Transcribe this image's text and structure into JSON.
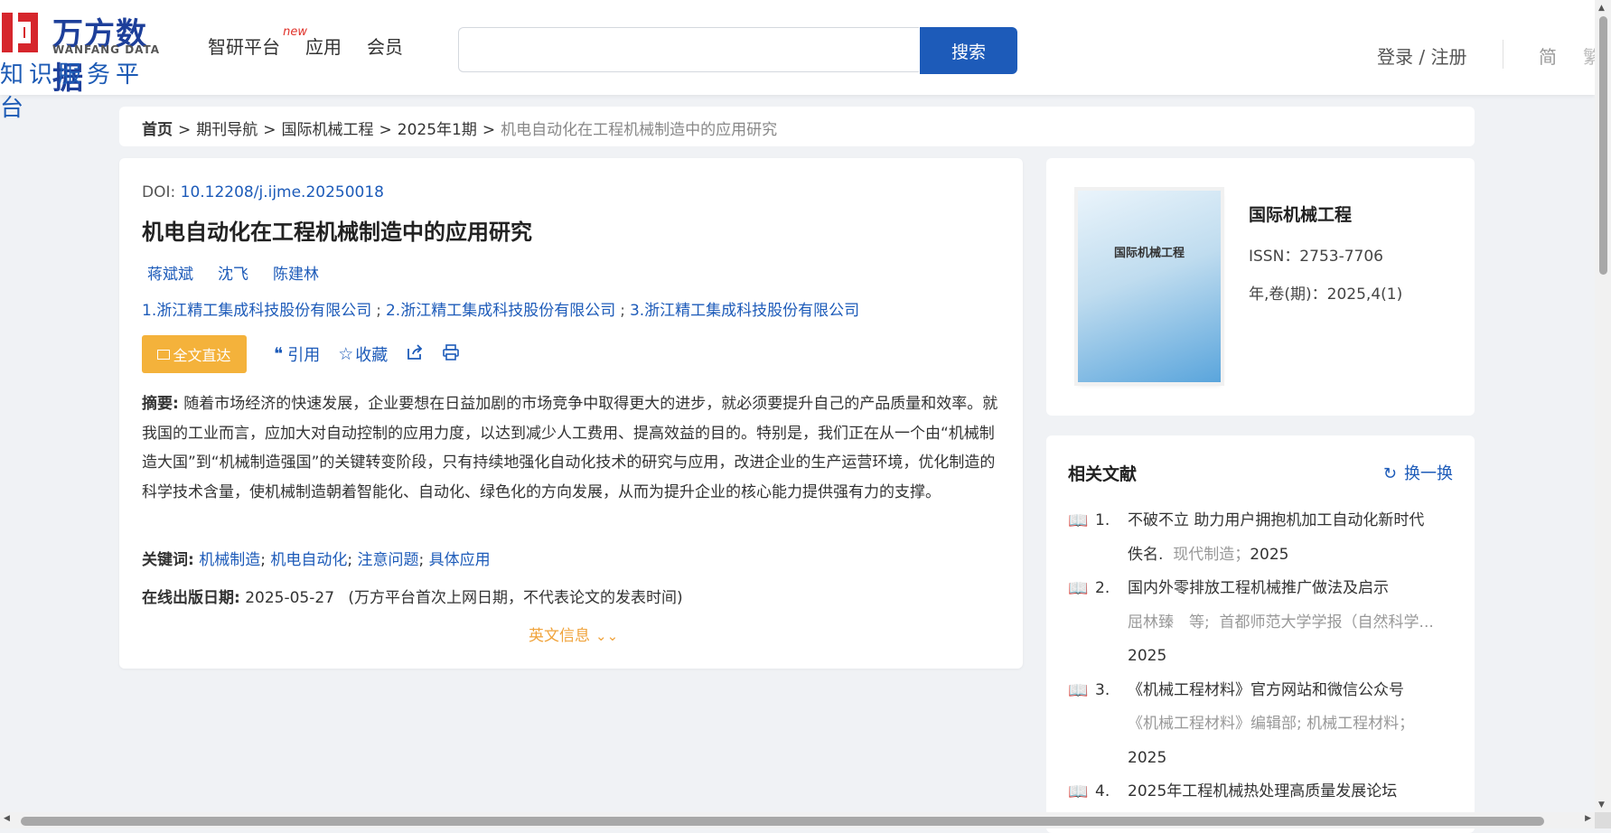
{
  "header": {
    "logo": {
      "cn": "万方数据",
      "en": "WANFANG DATA",
      "sub": "知识服务平台"
    },
    "nav": [
      {
        "label": "智研平台",
        "badge": "new"
      },
      {
        "label": "应用"
      },
      {
        "label": "会员"
      }
    ],
    "search": {
      "placeholder": "",
      "button_label": "搜索"
    },
    "login_label": "登录 / 注册",
    "lang_simplified": "简",
    "lang_traditional": "繁"
  },
  "breadcrumb": {
    "home": "首页",
    "items": [
      "期刊导航",
      "国际机械工程",
      "2025年1期"
    ],
    "current": "机电自动化在工程机械制造中的应用研究",
    "separator": ">"
  },
  "article": {
    "doi_label": "DOI: ",
    "doi": "10.12208/j.ijme.20250018",
    "title": "机电自动化在工程机械制造中的应用研究",
    "authors": [
      "蒋斌斌",
      "沈飞",
      "陈建林"
    ],
    "orgs": [
      "1.浙江精工集成科技股份有限公司",
      "2.浙江精工集成科技股份有限公司",
      "3.浙江精工集成科技股份有限公司"
    ],
    "org_sep": ";",
    "actions": {
      "fulltext": "全文直达",
      "cite": "引用",
      "favorite": "收藏"
    },
    "abstract_label": "摘要:",
    "abstract": "随着市场经济的快速发展，企业要想在日益加剧的市场竞争中取得更大的进步，就必须要提升自己的产品质量和效率。就我国的工业而言，应加大对自动控制的应用力度，以达到减少人工费用、提高效益的目的。特别是，我们正在从一个由“机械制造大国”到“机械制造强国”的关键转变阶段，只有持续地强化自动化技术的研究与应用，改进企业的生产运营环境，优化制造的科学技术含量，使机械制造朝着智能化、自动化、绿色化的方向发展，从而为提升企业的核心能力提供强有力的支撑。",
    "keywords_label": "关键词:",
    "keywords": [
      "机械制造",
      "机电自动化",
      "注意问题",
      "具体应用"
    ],
    "pubdate_label": "在线出版日期:",
    "pubdate": "2025-05-27",
    "pubdate_note": "(万方平台首次上网日期，不代表论文的发表时间)",
    "english_info": "英文信息"
  },
  "journal": {
    "cover_title": "国际机械工程",
    "name": "国际机械工程",
    "issn": "ISSN：2753-7706",
    "volume": "年,卷(期)：2025,4(1)"
  },
  "related": {
    "title": "相关文献",
    "refresh_label": "换一换",
    "items": [
      {
        "num": "1.",
        "title": "不破不立 助力用户拥抱机加工自动化新时代",
        "author": "佚名.",
        "source": "现代制造；",
        "year": "2025"
      },
      {
        "num": "2.",
        "title": "国内外零排放工程机械推广做法及启示",
        "author": "屈林臻　等;",
        "source": "首都师范大学学报（自然科学...",
        "year": "2025"
      },
      {
        "num": "3.",
        "title": "《机械工程材料》官方网站和微信公众号",
        "author": "《机械工程材料》编辑部;",
        "source": "机械工程材料；",
        "year": "2025"
      },
      {
        "num": "4.",
        "title": "2025年工程机械热处理高质量发展论坛",
        "author": "",
        "source": "",
        "year": ""
      }
    ]
  },
  "colors": {
    "brand_blue": "#1d5bb9",
    "logo_red": "#d6262c",
    "accent_orange": "#f4b23b",
    "background": "#f0f2f5"
  },
  "icons": [
    "search-icon",
    "quote-icon",
    "star-icon",
    "share-icon",
    "print-icon",
    "book-icon",
    "refresh-icon",
    "chevron-down-icon"
  ]
}
